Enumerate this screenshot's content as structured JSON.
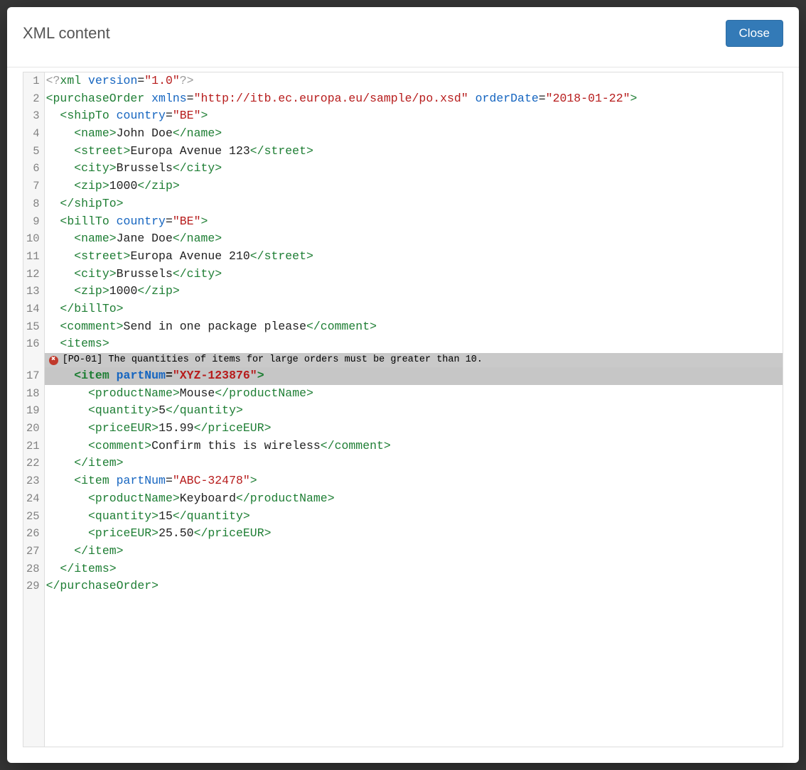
{
  "modal": {
    "title": "XML content",
    "close_label": "Close"
  },
  "annotation": {
    "line_number": 17,
    "text": "[PO-01] The quantities of items for large orders must be greater than 10."
  },
  "xml_data": {
    "xml_declaration": "<?xml version=\"1.0\"?>",
    "root": "purchaseOrder",
    "namespace": "http://itb.ec.europa.eu/sample/po.xsd",
    "orderDate": "2018-01-22",
    "shipTo": {
      "country": "BE",
      "name": "John Doe",
      "street": "Europa Avenue 123",
      "city": "Brussels",
      "zip": "1000"
    },
    "billTo": {
      "country": "BE",
      "name": "Jane Doe",
      "street": "Europa Avenue 210",
      "city": "Brussels",
      "zip": "1000"
    },
    "comment": "Send in one package please",
    "items": [
      {
        "partNum": "XYZ-123876",
        "productName": "Mouse",
        "quantity": "5",
        "priceEUR": "15.99",
        "comment": "Confirm this is wireless"
      },
      {
        "partNum": "ABC-32478",
        "productName": "Keyboard",
        "quantity": "15",
        "priceEUR": "25.50"
      }
    ]
  },
  "lines": [
    {
      "n": 1,
      "tokens": [
        [
          "dim",
          "<?"
        ],
        [
          "tag",
          "xml"
        ],
        [
          "txt",
          " "
        ],
        [
          "attr",
          "version"
        ],
        [
          "txt",
          "="
        ],
        [
          "str",
          "\"1.0\""
        ],
        [
          "dim",
          "?>"
        ]
      ]
    },
    {
      "n": 2,
      "tokens": [
        [
          "tag",
          "<purchaseOrder"
        ],
        [
          "txt",
          " "
        ],
        [
          "attr",
          "xmlns"
        ],
        [
          "txt",
          "="
        ],
        [
          "str",
          "\"http://itb.ec.europa.eu/sample/po.xsd\""
        ],
        [
          "txt",
          " "
        ],
        [
          "attr",
          "orderDate"
        ],
        [
          "txt",
          "="
        ],
        [
          "str",
          "\"2018-01-22\""
        ],
        [
          "tag",
          ">"
        ]
      ]
    },
    {
      "n": 3,
      "tokens": [
        [
          "txt",
          "  "
        ],
        [
          "tag",
          "<shipTo"
        ],
        [
          "txt",
          " "
        ],
        [
          "attr",
          "country"
        ],
        [
          "txt",
          "="
        ],
        [
          "str",
          "\"BE\""
        ],
        [
          "tag",
          ">"
        ]
      ]
    },
    {
      "n": 4,
      "tokens": [
        [
          "txt",
          "    "
        ],
        [
          "tag",
          "<name>"
        ],
        [
          "txt",
          "John Doe"
        ],
        [
          "tag",
          "</name>"
        ]
      ]
    },
    {
      "n": 5,
      "tokens": [
        [
          "txt",
          "    "
        ],
        [
          "tag",
          "<street>"
        ],
        [
          "txt",
          "Europa Avenue 123"
        ],
        [
          "tag",
          "</street>"
        ]
      ]
    },
    {
      "n": 6,
      "tokens": [
        [
          "txt",
          "    "
        ],
        [
          "tag",
          "<city>"
        ],
        [
          "txt",
          "Brussels"
        ],
        [
          "tag",
          "</city>"
        ]
      ]
    },
    {
      "n": 7,
      "tokens": [
        [
          "txt",
          "    "
        ],
        [
          "tag",
          "<zip>"
        ],
        [
          "txt",
          "1000"
        ],
        [
          "tag",
          "</zip>"
        ]
      ]
    },
    {
      "n": 8,
      "tokens": [
        [
          "txt",
          "  "
        ],
        [
          "tag",
          "</shipTo>"
        ]
      ]
    },
    {
      "n": 9,
      "tokens": [
        [
          "txt",
          "  "
        ],
        [
          "tag",
          "<billTo"
        ],
        [
          "txt",
          " "
        ],
        [
          "attr",
          "country"
        ],
        [
          "txt",
          "="
        ],
        [
          "str",
          "\"BE\""
        ],
        [
          "tag",
          ">"
        ]
      ]
    },
    {
      "n": 10,
      "tokens": [
        [
          "txt",
          "    "
        ],
        [
          "tag",
          "<name>"
        ],
        [
          "txt",
          "Jane Doe"
        ],
        [
          "tag",
          "</name>"
        ]
      ]
    },
    {
      "n": 11,
      "tokens": [
        [
          "txt",
          "    "
        ],
        [
          "tag",
          "<street>"
        ],
        [
          "txt",
          "Europa Avenue 210"
        ],
        [
          "tag",
          "</street>"
        ]
      ]
    },
    {
      "n": 12,
      "tokens": [
        [
          "txt",
          "    "
        ],
        [
          "tag",
          "<city>"
        ],
        [
          "txt",
          "Brussels"
        ],
        [
          "tag",
          "</city>"
        ]
      ]
    },
    {
      "n": 13,
      "tokens": [
        [
          "txt",
          "    "
        ],
        [
          "tag",
          "<zip>"
        ],
        [
          "txt",
          "1000"
        ],
        [
          "tag",
          "</zip>"
        ]
      ]
    },
    {
      "n": 14,
      "tokens": [
        [
          "txt",
          "  "
        ],
        [
          "tag",
          "</billTo>"
        ]
      ]
    },
    {
      "n": 15,
      "tokens": [
        [
          "txt",
          "  "
        ],
        [
          "tag",
          "<comment>"
        ],
        [
          "txt",
          "Send in one package please"
        ],
        [
          "tag",
          "</comment>"
        ]
      ]
    },
    {
      "n": 16,
      "tokens": [
        [
          "txt",
          "  "
        ],
        [
          "tag",
          "<items>"
        ]
      ]
    },
    {
      "n": 17,
      "hl": true,
      "tokens": [
        [
          "txt",
          "    "
        ],
        [
          "tag",
          "<item"
        ],
        [
          "txt",
          " "
        ],
        [
          "attr",
          "partNum"
        ],
        [
          "txt",
          "="
        ],
        [
          "str",
          "\"XYZ-123876\""
        ],
        [
          "tag",
          ">"
        ]
      ]
    },
    {
      "n": 18,
      "tokens": [
        [
          "txt",
          "      "
        ],
        [
          "tag",
          "<productName>"
        ],
        [
          "txt",
          "Mouse"
        ],
        [
          "tag",
          "</productName>"
        ]
      ]
    },
    {
      "n": 19,
      "tokens": [
        [
          "txt",
          "      "
        ],
        [
          "tag",
          "<quantity>"
        ],
        [
          "txt",
          "5"
        ],
        [
          "tag",
          "</quantity>"
        ]
      ]
    },
    {
      "n": 20,
      "tokens": [
        [
          "txt",
          "      "
        ],
        [
          "tag",
          "<priceEUR>"
        ],
        [
          "txt",
          "15.99"
        ],
        [
          "tag",
          "</priceEUR>"
        ]
      ]
    },
    {
      "n": 21,
      "tokens": [
        [
          "txt",
          "      "
        ],
        [
          "tag",
          "<comment>"
        ],
        [
          "txt",
          "Confirm this is wireless"
        ],
        [
          "tag",
          "</comment>"
        ]
      ]
    },
    {
      "n": 22,
      "tokens": [
        [
          "txt",
          "    "
        ],
        [
          "tag",
          "</item>"
        ]
      ]
    },
    {
      "n": 23,
      "tokens": [
        [
          "txt",
          "    "
        ],
        [
          "tag",
          "<item"
        ],
        [
          "txt",
          " "
        ],
        [
          "attr",
          "partNum"
        ],
        [
          "txt",
          "="
        ],
        [
          "str",
          "\"ABC-32478\""
        ],
        [
          "tag",
          ">"
        ]
      ]
    },
    {
      "n": 24,
      "tokens": [
        [
          "txt",
          "      "
        ],
        [
          "tag",
          "<productName>"
        ],
        [
          "txt",
          "Keyboard"
        ],
        [
          "tag",
          "</productName>"
        ]
      ]
    },
    {
      "n": 25,
      "tokens": [
        [
          "txt",
          "      "
        ],
        [
          "tag",
          "<quantity>"
        ],
        [
          "txt",
          "15"
        ],
        [
          "tag",
          "</quantity>"
        ]
      ]
    },
    {
      "n": 26,
      "tokens": [
        [
          "txt",
          "      "
        ],
        [
          "tag",
          "<priceEUR>"
        ],
        [
          "txt",
          "25.50"
        ],
        [
          "tag",
          "</priceEUR>"
        ]
      ]
    },
    {
      "n": 27,
      "tokens": [
        [
          "txt",
          "    "
        ],
        [
          "tag",
          "</item>"
        ]
      ]
    },
    {
      "n": 28,
      "tokens": [
        [
          "txt",
          "  "
        ],
        [
          "tag",
          "</items>"
        ]
      ]
    },
    {
      "n": 29,
      "tokens": [
        [
          "tag",
          "</purchaseOrder>"
        ]
      ]
    }
  ]
}
